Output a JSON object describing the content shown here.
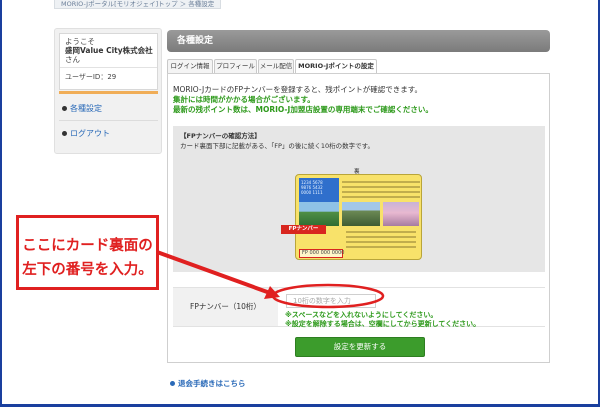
{
  "breadcrumb": "MORIO-Jポータル[モリオジェイ]トップ ＞ 各種設定",
  "sidebar": {
    "welcome": "ようこそ",
    "company": "盛岡Value City株式会社",
    "honorific": "さん",
    "user_id": "ユーザーID：29",
    "links": [
      {
        "label": "各種設定"
      },
      {
        "label": "ログアウト"
      }
    ]
  },
  "header": {
    "title": "各種設定"
  },
  "tabs": [
    {
      "label": "ログイン情報"
    },
    {
      "label": "プロフィール"
    },
    {
      "label": "メール配信"
    },
    {
      "label": "MORIO-Jポイントの設定"
    }
  ],
  "intro": {
    "line1": "MORIO-JカードのFPナンバーを登録すると、残ポイントが確認できます。",
    "line2": "集計には時間がかかる場合がございます。",
    "line3": "最新の残ポイント数は、MORIO-J加盟店設置の専用端末でご確認ください。"
  },
  "info": {
    "title": "【FPナンバーの確認方法】",
    "desc": "カード裏面下部に記載がある、「FP」の後に続く10桁の数字です。",
    "card_label": "裏",
    "card_map_text": "1234 5678\n9876 5432\n0000 1111",
    "card_number": "FP 000 000 0000",
    "fp_tag": "FPナンバー"
  },
  "form": {
    "label": "FPナンバー（10桁）",
    "input_value": "",
    "input_placeholder": "10桁の数字を入力",
    "note1": "※スペースなどを入れないようにしてください。",
    "note2": "※設定を解除する場合は、空欄にしてから更新してください。",
    "submit_label": "設定を更新する"
  },
  "footer_link": "退会手続きはこちら",
  "callout": {
    "line1": "ここにカード裏面の",
    "line2": "左下の番号を入力。"
  },
  "colors": {
    "accent_green": "#3c9c2c",
    "note_green": "#2e9a1c",
    "link_blue": "#2a6ab8",
    "annotation_red": "#e02020",
    "border_blue": "#1a3f9e"
  }
}
